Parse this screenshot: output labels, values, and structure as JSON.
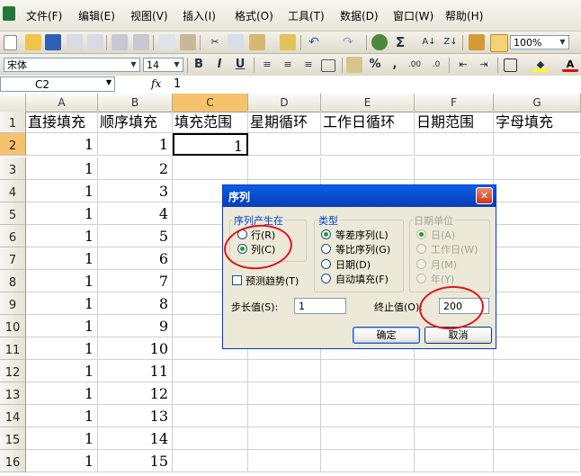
{
  "menu": [
    "文件(F)",
    "编辑(E)",
    "视图(V)",
    "插入(I)",
    "格式(O)",
    "工具(T)",
    "数据(D)",
    "窗口(W)",
    "帮助(H)"
  ],
  "toolbar": {
    "zoom": "100%",
    "font_name": "宋体",
    "font_size": "14",
    "bold": "B",
    "italic": "I",
    "underline": "U",
    "percent": "%",
    "comma": ",",
    "sigma": "Σ"
  },
  "formula_bar": {
    "name_box": "C2",
    "fx": "fx",
    "content": "1"
  },
  "columns": [
    "A",
    "B",
    "C",
    "D",
    "E",
    "F",
    "G"
  ],
  "header_row": [
    "直接填充",
    "顺序填充",
    "填充范围",
    "星期循环",
    "工作日循环",
    "日期范围",
    "字母填充"
  ],
  "rows": [
    {
      "num": "1"
    },
    {
      "num": "2",
      "a": "1",
      "b": "1",
      "c": "1"
    },
    {
      "num": "3",
      "a": "1",
      "b": "2"
    },
    {
      "num": "4",
      "a": "1",
      "b": "3"
    },
    {
      "num": "5",
      "a": "1",
      "b": "4"
    },
    {
      "num": "6",
      "a": "1",
      "b": "5"
    },
    {
      "num": "7",
      "a": "1",
      "b": "6"
    },
    {
      "num": "8",
      "a": "1",
      "b": "7"
    },
    {
      "num": "9",
      "a": "1",
      "b": "8"
    },
    {
      "num": "10",
      "a": "1",
      "b": "9"
    },
    {
      "num": "11",
      "a": "1",
      "b": "10"
    },
    {
      "num": "12",
      "a": "1",
      "b": "11"
    },
    {
      "num": "13",
      "a": "1",
      "b": "12"
    },
    {
      "num": "14",
      "a": "1",
      "b": "13"
    },
    {
      "num": "15",
      "a": "1",
      "b": "14"
    },
    {
      "num": "16",
      "a": "1",
      "b": "15"
    }
  ],
  "dialog": {
    "title": "序列",
    "series_in": {
      "label": "序列产生在",
      "rows": "行(R)",
      "columns": "列(C)",
      "selected": "columns"
    },
    "type": {
      "label": "类型",
      "linear": "等差序列(L)",
      "growth": "等比序列(G)",
      "date": "日期(D)",
      "autofill": "自动填充(F)",
      "selected": "linear"
    },
    "date_unit": {
      "label": "日期单位",
      "day": "日(A)",
      "weekday": "工作日(W)",
      "month": "月(M)",
      "year": "年(Y)"
    },
    "trend": "预测趋势(T)",
    "step_label": "步长值(S):",
    "step_value": "1",
    "stop_label": "终止值(O):",
    "stop_value": "200",
    "ok": "确定",
    "cancel": "取消",
    "close": "✕"
  },
  "colors": {
    "selected_header": "#f6c26b",
    "title_bar": "#0b49c8",
    "annotation": "#e0141c"
  }
}
